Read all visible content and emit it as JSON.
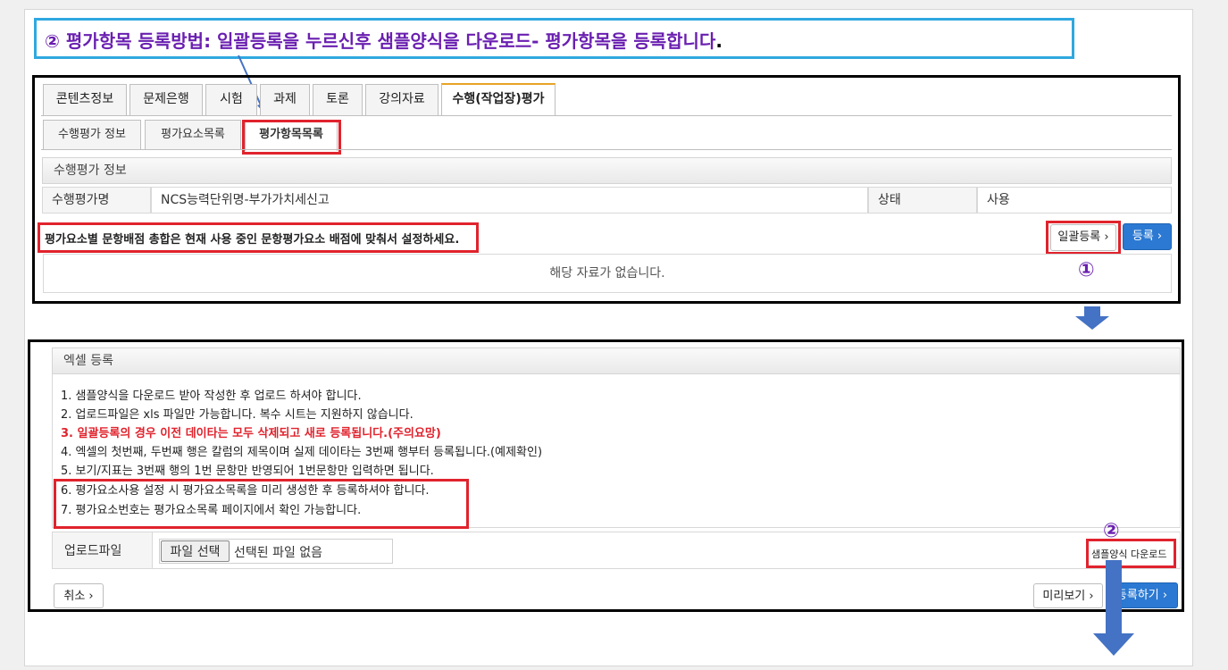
{
  "callout": {
    "circle": "②",
    "text": "평가항목 등록방법: 일괄등록을 누르신후 샘플양식을 다운로드- 평가항목을 등록합니다",
    "period": "."
  },
  "tabs": [
    "콘텐츠정보",
    "문제은행",
    "시험",
    "과제",
    "토론",
    "강의자료",
    "수행(작업장)평가"
  ],
  "subtabs": [
    "수행평가 정보",
    "평가요소목록",
    "평가항목목록"
  ],
  "info": {
    "section_title": "수행평가 정보",
    "name_label": "수행평가명",
    "name_value": "NCS능력단위명-부가가치세신고",
    "status_label": "상태",
    "status_value": "사용"
  },
  "notice": "평가요소별 문항배점 총합은 현재 사용 중인 문항평가요소 배점에 맞춰서 설정하세요.",
  "actions": {
    "bulk_register": "일괄등록 ›",
    "register": "등록 ›"
  },
  "empty_message": "해당 자료가 없습니다.",
  "markers": {
    "one": "①",
    "two": "②"
  },
  "excel": {
    "title": "엑셀 등록",
    "guides": [
      "1. 샘플양식을 다운로드 받아 작성한 후 업로드 하셔야 합니다.",
      "2. 업로드파일은 xls 파일만 가능합니다. 복수 시트는 지원하지 않습니다.",
      "3. 일괄등록의 경우 이전 데이타는 모두 삭제되고 새로 등록됩니다.(주의요망)",
      "4. 엑셀의 첫번째, 두번째 행은 칼럼의 제목이며 실제 데이타는 3번째 행부터 등록됩니다.(예제확인)",
      "5. 보기/지표는 3번째 행의 1번 문항만 반영되어 1번문항만 입력하면 됩니다.",
      "6. 평가요소사용 설정 시 평가요소목록을 미리 생성한 후 등록하셔야 합니다.",
      "7. 평가요소번호는 평가요소목록 페이지에서 확인 가능합니다."
    ],
    "upload_label": "업로드파일",
    "file_button": "파일 선택",
    "file_status": "선택된 파일 없음",
    "sample_download": "샘플양식 다운로드",
    "cancel": "취소 ›",
    "preview": "미리보기 ›",
    "submit": "등록하기 ›"
  },
  "colors": {
    "callout_border": "#2fa8e0",
    "callout_text": "#6a1fb0",
    "highlight": "#e0232d",
    "primary": "#2b79d2",
    "arrow": "#4472c4"
  }
}
